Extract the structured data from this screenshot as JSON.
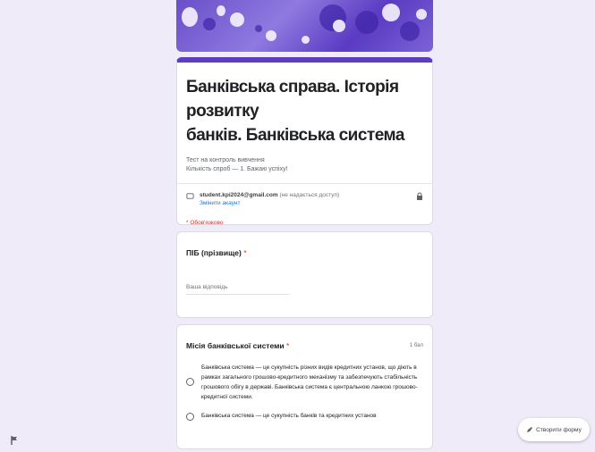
{
  "form": {
    "title_line1": "Банківська справа. Історія розвитку",
    "title_line2": "банків. Банківська система",
    "description_line1": "Тест на контроль вивчення",
    "description_line2": "Кількість спроб — 1. Бажаю успіху!"
  },
  "account": {
    "email": "student.kpi2024@gmail.com",
    "switch_text": "(не надається доступ)",
    "switch_link": "Змінити акаунт"
  },
  "required_note": "* Обов'язково",
  "questions": [
    {
      "title": "ПІБ (прізвище)",
      "required_marker": "*",
      "placeholder": "Ваша відповідь"
    },
    {
      "title": "Місія банківської системи",
      "required_marker": "*",
      "points": "1 бал",
      "options": [
        "Банківська система — це сукупність різних видів кредитних установ, що діють в рамках загального грошово-кредитного механізму та забезпечують стабільність грошового обігу в державі. Банківська система є центральною ланкою грошово-кредитної системи.",
        "Банківська система — це сукупність банків та кредитних установ"
      ]
    }
  ],
  "side_button": {
    "label": "Створити форму"
  },
  "colors": {
    "accent": "#5b3ec1",
    "background": "#f0ebf8",
    "required": "#d93025",
    "link": "#1a73e8"
  }
}
